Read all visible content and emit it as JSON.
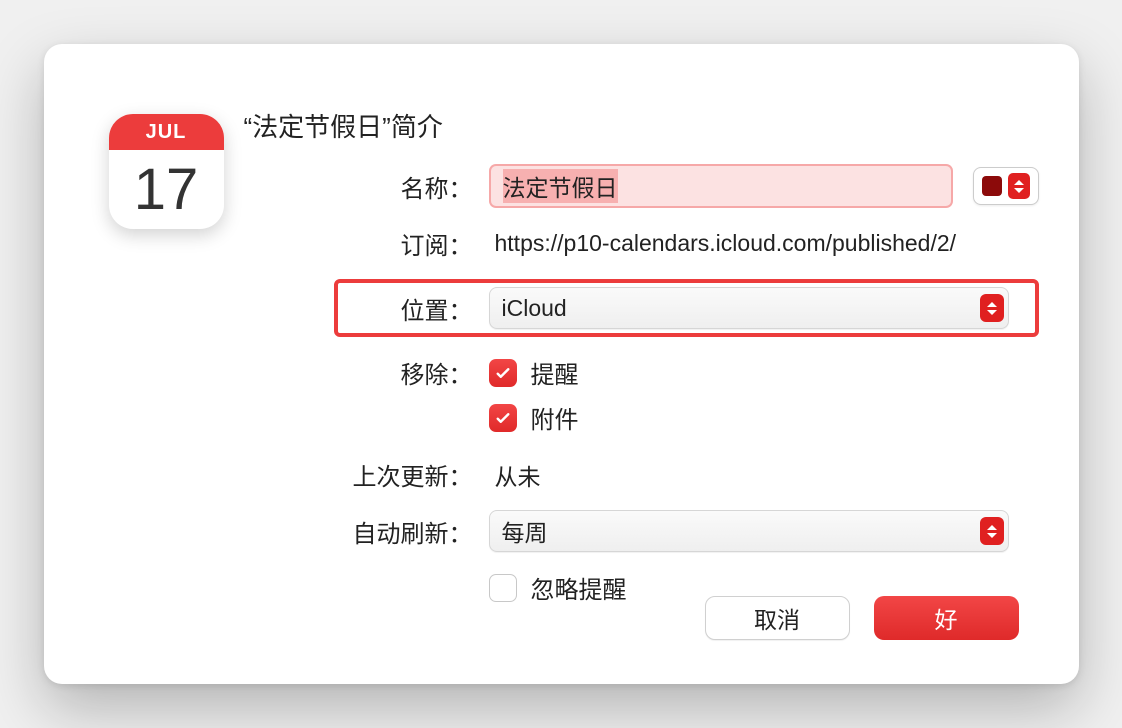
{
  "icon": {
    "month": "JUL",
    "day": "17"
  },
  "title": "“法定节假日”简介",
  "labels": {
    "name": "名称：",
    "subscribe": "订阅：",
    "location": "位置：",
    "remove": "移除：",
    "last_update": "上次更新：",
    "auto_refresh": "自动刷新："
  },
  "values": {
    "name": "法定节假日",
    "subscribe_url": "https://p10-calendars.icloud.com/published/2/",
    "location": "iCloud",
    "remove_alerts": "提醒",
    "remove_attachments": "附件",
    "last_update": "从未",
    "auto_refresh": "每周",
    "ignore_alerts": "忽略提醒"
  },
  "color": "#8c0a0a",
  "buttons": {
    "cancel": "取消",
    "ok": "好"
  }
}
